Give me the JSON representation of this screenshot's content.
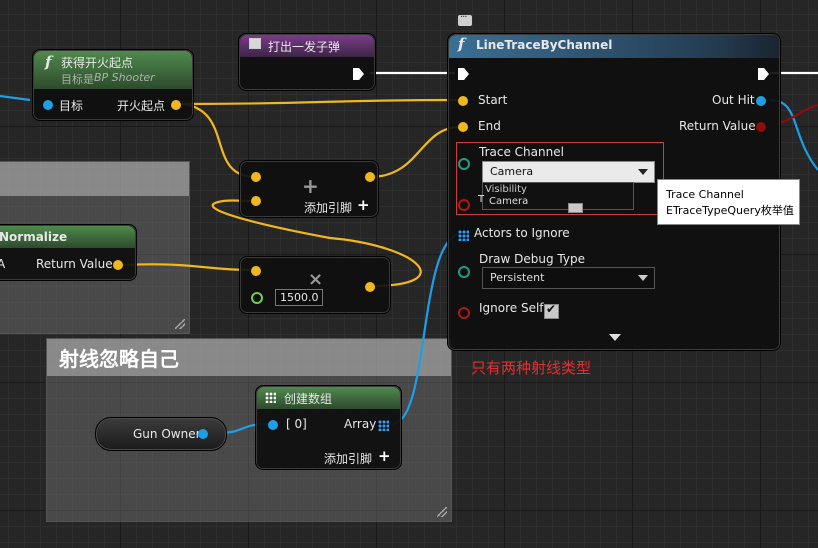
{
  "top_icon": "comment-bubble-icon",
  "comments": {
    "left_title": "",
    "bottom_title": "射线忽略自己"
  },
  "node_get_fire_start": {
    "title": "获得开火起点",
    "subtitle_prefix": "目标是",
    "subtitle_class": "BP Shooter",
    "pin_target": "目标",
    "pin_out": "开火起点"
  },
  "node_fire_one_bullet": {
    "title": "打出一发子弹"
  },
  "node_add": {
    "symbol": "+",
    "add_pin": "添加引脚"
  },
  "node_normalize": {
    "title": "Normalize",
    "pin_a": "A",
    "pin_out": "Return Value"
  },
  "node_multiply": {
    "symbol": "×",
    "value": "1500.0"
  },
  "node_line_trace": {
    "title": "LineTraceByChannel",
    "pin_start": "Start",
    "pin_end": "End",
    "pin_out_hit": "Out Hit",
    "pin_return": "Return Value",
    "pin_trace_channel": "Trace Channel",
    "trace_channel_value": "Camera",
    "dropdown_options": [
      "Visibility",
      "Camera"
    ],
    "pin_trace_complex_partial": "T",
    "pin_actors_ignore": "Actors to Ignore",
    "pin_draw_debug": "Draw Debug Type",
    "draw_debug_value": "Persistent",
    "pin_ignore_self": "Ignore Self",
    "ignore_self_checked": "✔",
    "expand_icon": "expand-arrow-icon"
  },
  "tooltip": {
    "line1": "Trace Channel",
    "line2": "ETraceTypeQuery枚举值"
  },
  "annotation": {
    "text": "只有两种射线类型",
    "color": "#e23030"
  },
  "node_make_array": {
    "title": "创建数组",
    "pin_in": "[ 0]",
    "pin_out": "Array",
    "add_pin": "添加引脚"
  },
  "node_gun_owner": {
    "label": "Gun Owner"
  },
  "colors": {
    "exec_wire": "#ffffff",
    "vector_wire": "#f0b81c",
    "object_wire": "#1b9fe6",
    "struct_wire": "#8c0d0d",
    "function_header": "#2e5470",
    "pure_header": "#3d6b3d"
  }
}
